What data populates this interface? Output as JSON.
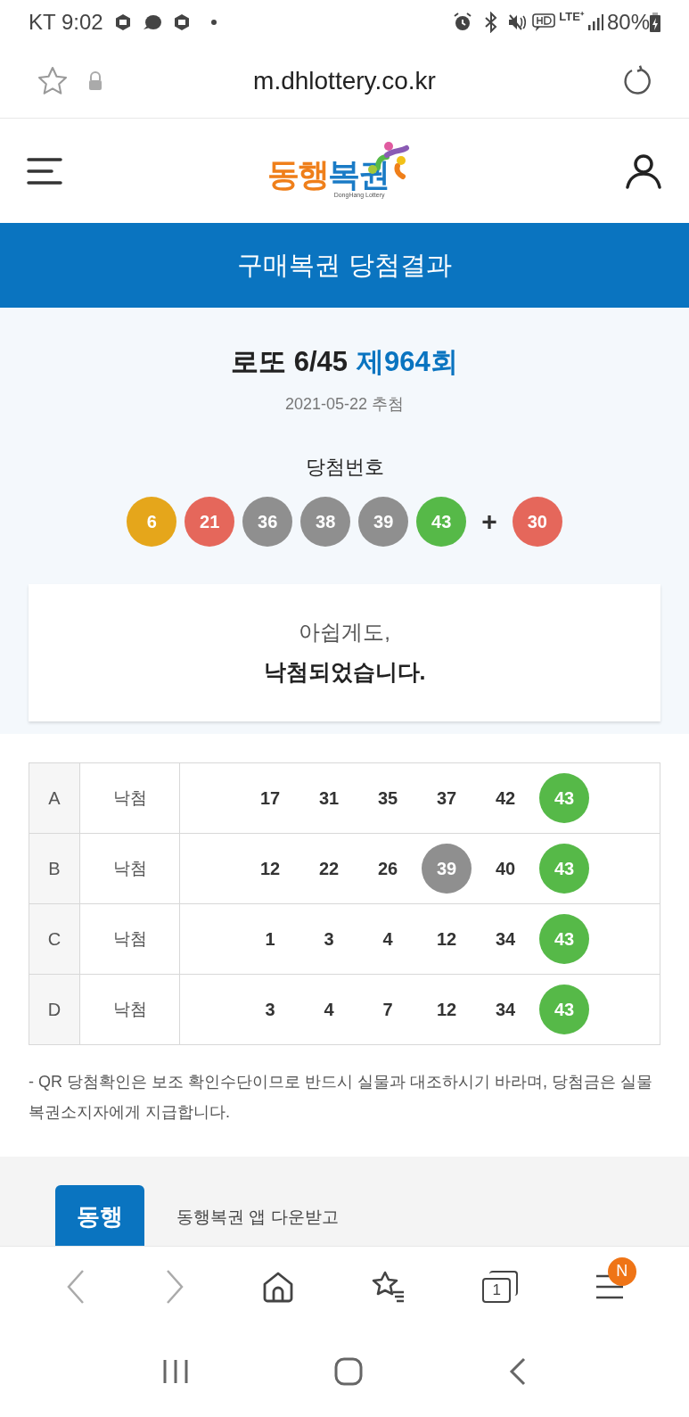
{
  "status_bar": {
    "carrier": "KT",
    "time": "9:02",
    "lte": "LTE⁺",
    "battery": "80%"
  },
  "browser": {
    "url": "m.dhlottery.co.kr"
  },
  "header": {
    "logo_left": "동행",
    "logo_right": "복권",
    "logo_sub": "DongHang Lottery"
  },
  "page_title": "구매복권 당첨결과",
  "draw": {
    "game": "로또 6/45",
    "round": "제964회",
    "date": "2021-05-22 추첨",
    "numbers_label": "당첨번호",
    "balls": [
      {
        "value": "6",
        "color": "#e5a61b"
      },
      {
        "value": "21",
        "color": "#e5675b"
      },
      {
        "value": "36",
        "color": "#8f8f8f"
      },
      {
        "value": "38",
        "color": "#8f8f8f"
      },
      {
        "value": "39",
        "color": "#8f8f8f"
      },
      {
        "value": "43",
        "color": "#56b948"
      }
    ],
    "plus": "+",
    "bonus": {
      "value": "30",
      "color": "#e5675b"
    }
  },
  "result": {
    "line1": "아쉽게도,",
    "line2": "낙첨되었습니다."
  },
  "tickets": [
    {
      "label": "A",
      "status": "낙첨",
      "numbers": [
        {
          "value": "17",
          "matched": false
        },
        {
          "value": "31",
          "matched": false
        },
        {
          "value": "35",
          "matched": false
        },
        {
          "value": "37",
          "matched": false
        },
        {
          "value": "42",
          "matched": false
        },
        {
          "value": "43",
          "matched": true,
          "color": "#56b948"
        }
      ]
    },
    {
      "label": "B",
      "status": "낙첨",
      "numbers": [
        {
          "value": "12",
          "matched": false
        },
        {
          "value": "22",
          "matched": false
        },
        {
          "value": "26",
          "matched": false
        },
        {
          "value": "39",
          "matched": true,
          "color": "#8f8f8f"
        },
        {
          "value": "40",
          "matched": false
        },
        {
          "value": "43",
          "matched": true,
          "color": "#56b948"
        }
      ]
    },
    {
      "label": "C",
      "status": "낙첨",
      "numbers": [
        {
          "value": "1",
          "matched": false
        },
        {
          "value": "3",
          "matched": false
        },
        {
          "value": "4",
          "matched": false
        },
        {
          "value": "12",
          "matched": false
        },
        {
          "value": "34",
          "matched": false
        },
        {
          "value": "43",
          "matched": true,
          "color": "#56b948"
        }
      ]
    },
    {
      "label": "D",
      "status": "낙첨",
      "numbers": [
        {
          "value": "3",
          "matched": false
        },
        {
          "value": "4",
          "matched": false
        },
        {
          "value": "7",
          "matched": false
        },
        {
          "value": "12",
          "matched": false
        },
        {
          "value": "34",
          "matched": false
        },
        {
          "value": "43",
          "matched": true,
          "color": "#56b948"
        }
      ]
    }
  ],
  "notice": "- QR 당첨확인은 보조 확인수단이므로 반드시 실물과 대조하시기 바라며, 당첨금은 실물 복권소지자에게 지급합니다.",
  "app_banner": {
    "icon_text": "동행",
    "text": "동행복권 앱 다운받고"
  },
  "browser_nav": {
    "tabs_count": "1",
    "menu_badge": "N"
  }
}
